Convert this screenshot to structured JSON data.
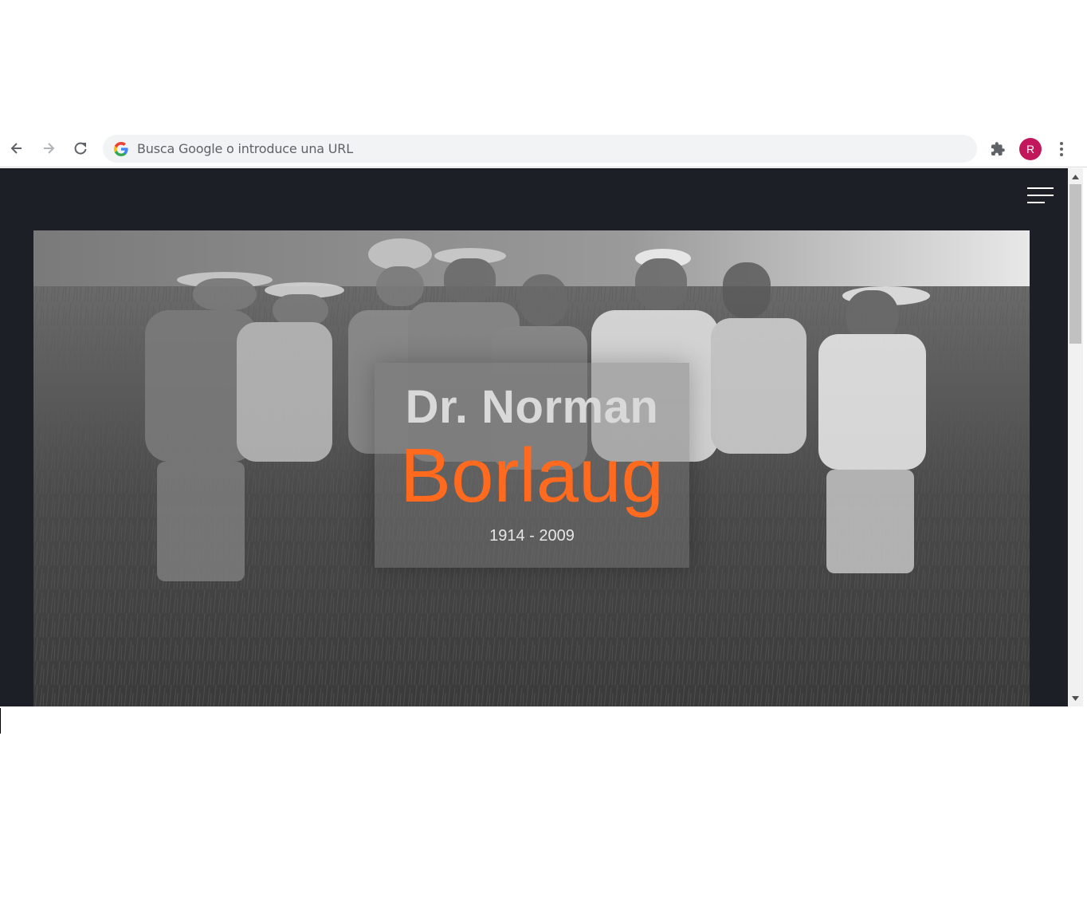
{
  "browser": {
    "omnibox_placeholder": "Busca Google o introduce una URL",
    "profile_initial": "R",
    "profile_color": "#c2185b",
    "icons": {
      "back": "arrow-left-icon",
      "forward": "arrow-right-icon",
      "reload": "reload-icon",
      "google": "google-g-icon",
      "extensions": "puzzle-icon",
      "menu": "kebab-menu-icon"
    }
  },
  "page": {
    "background_color": "#1c1f26",
    "accent_color": "#ff6a1f",
    "menu_icon": "hamburger-icon",
    "hero": {
      "image_description_icon": "hero-photo",
      "title_top": "Dr. Norman",
      "title_main": "Borlaug",
      "years": "1914 - 2009"
    }
  }
}
